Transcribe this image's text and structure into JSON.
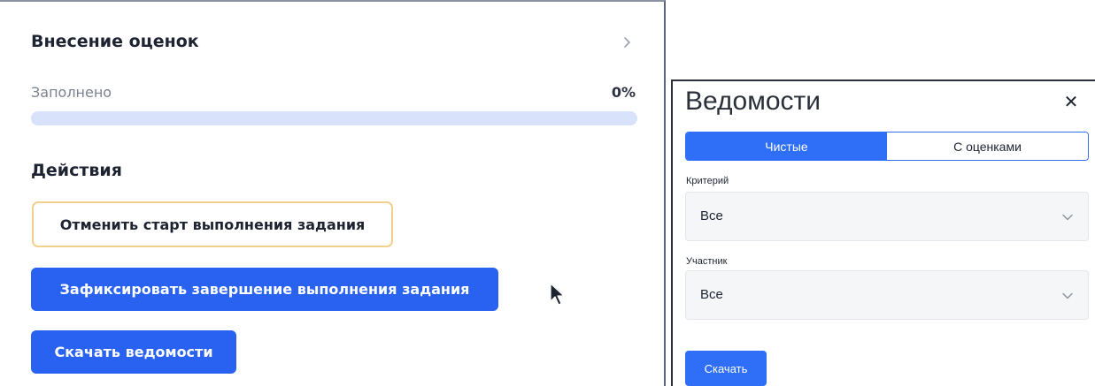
{
  "grading": {
    "title": "Внесение оценок",
    "open_icon": "chevron-right-icon",
    "filled_label": "Заполнено",
    "filled_value": "0%",
    "progress_fraction": 0
  },
  "actions": {
    "heading": "Действия",
    "cancel_start_label": "Отменить старт выполнения задания",
    "finish_label": "Зафиксировать завершение выполнения задания",
    "download_label": "Скачать ведомости"
  },
  "modal": {
    "title": "Ведомости",
    "close_icon": "close-icon",
    "tabs": [
      {
        "label": "Чистые",
        "active": true
      },
      {
        "label": "С оценками",
        "active": false
      }
    ],
    "criterion": {
      "label": "Критерий",
      "value": "Все"
    },
    "participant": {
      "label": "Участник",
      "value": "Все"
    },
    "download_label": "Скачать"
  },
  "colors": {
    "primary": "#2962f0",
    "progress_track": "#d9e2fb",
    "outline_button_border": "#f2cf8a"
  }
}
